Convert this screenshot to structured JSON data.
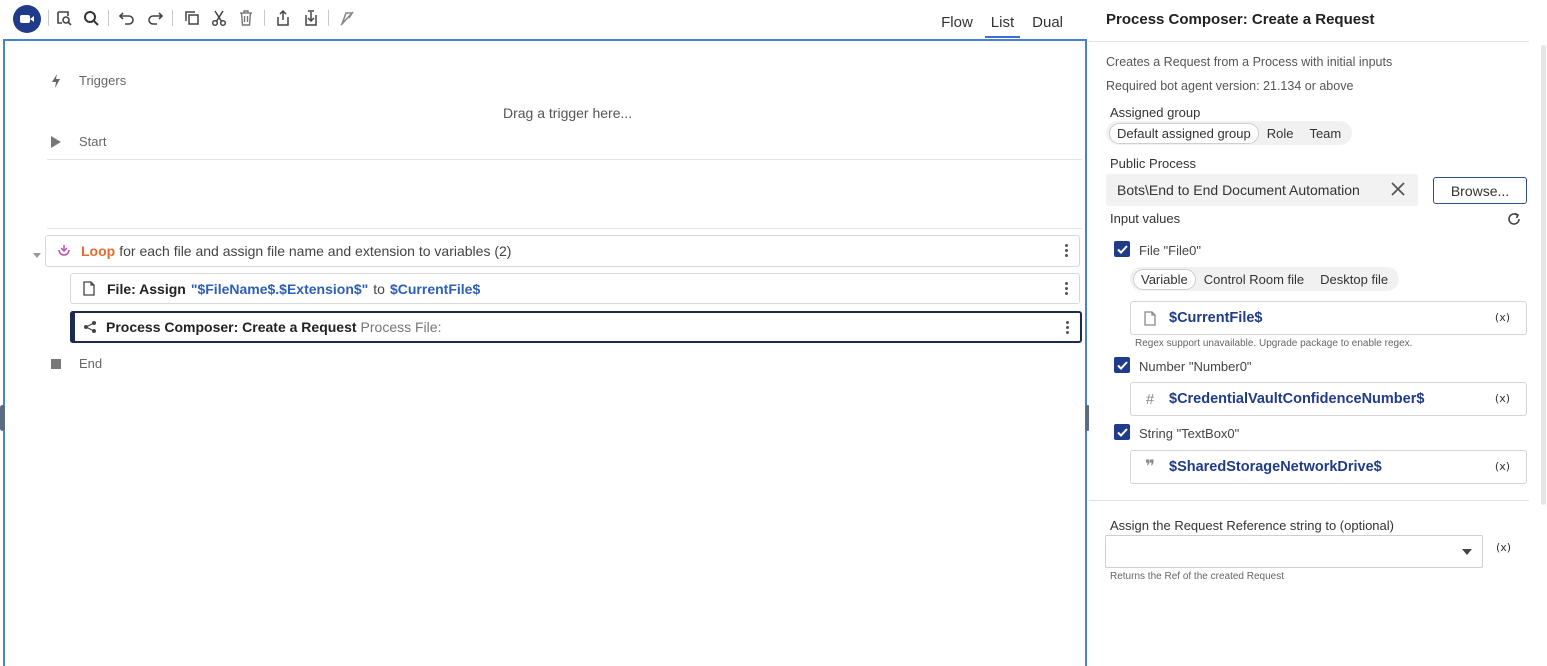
{
  "toolbar": {
    "icons": [
      "record-icon",
      "find-in-page-icon",
      "search-icon",
      "undo-icon",
      "redo-icon",
      "copy-icon",
      "cut-icon",
      "delete-icon",
      "export-icon",
      "import-icon",
      "disable-icon"
    ],
    "view_tabs": [
      {
        "label": "Flow",
        "active": false
      },
      {
        "label": "List",
        "active": true
      },
      {
        "label": "Dual",
        "active": false
      }
    ]
  },
  "canvas": {
    "triggers_label": "Triggers",
    "drag_hint": "Drag a trigger here...",
    "start_label": "Start",
    "end_label": "End",
    "loop": {
      "keyword": "Loop",
      "description": "for each file and assign file name and extension to variables (2)"
    },
    "file_assign": {
      "title": "File: Assign",
      "value": "\"$FileName$.$Extension$\"",
      "connector": "to",
      "target": "$CurrentFile$"
    },
    "process_action": {
      "title": "Process Composer: Create a Request",
      "detail": "Process File:"
    }
  },
  "panel": {
    "title": "Process Composer: Create a Request",
    "description": "Creates a Request from a Process with initial inputs",
    "requirement": "Required bot agent version: 21.134 or above",
    "assigned_group_label": "Assigned group",
    "assigned_group_options": [
      "Default assigned group",
      "Role",
      "Team"
    ],
    "public_process_label": "Public Process",
    "public_process_value": "Bots\\End to End Document Automation",
    "browse_label": "Browse...",
    "input_values_label": "Input values",
    "file_input": {
      "label": "File \"File0\"",
      "options": [
        "Variable",
        "Control Room file",
        "Desktop file"
      ],
      "value": "$CurrentFile$",
      "hint": "Regex support unavailable. Upgrade package to enable regex."
    },
    "number_input": {
      "label": "Number \"Number0\"",
      "value": "$CredentialVaultConfidenceNumber$"
    },
    "string_input": {
      "label": "String \"TextBox0\"",
      "value": "$SharedStorageNetworkDrive$"
    },
    "variable_button": "(x)",
    "assign_label": "Assign the Request Reference string to (optional)",
    "assign_value": "",
    "assign_hint": "Returns the Ref of the created Request"
  },
  "colors": {
    "accent": "#1f3b8a",
    "canvas_border": "#4a7fd6",
    "loop_keyword": "#e06b2d",
    "variable_text": "#2d5fb8"
  }
}
